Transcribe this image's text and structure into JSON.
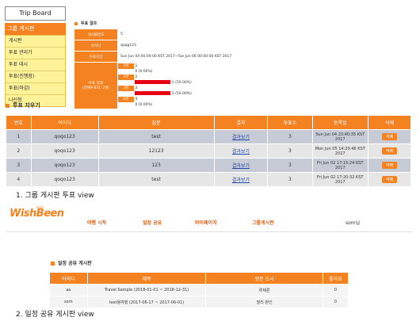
{
  "sidebar": {
    "title": "Trip Board",
    "category": "그룹 게시판",
    "items": [
      "게시판",
      "투표 관리기",
      "투표 대시",
      "투표(진행함)",
      "투표(마감)",
      "나신청"
    ]
  },
  "vote_detail": {
    "header": "투표 결과",
    "rows": [
      {
        "label": "게시물번호",
        "value": "5"
      },
      {
        "label": "아이디",
        "value": "qaqg123"
      },
      {
        "label": "투표기간",
        "value": "Sun Jun 04 00:00:00 KST 2017~Tue Jun 06 00:00:00 KST 2017"
      }
    ],
    "result_label": "투표 결과",
    "result_sublabel": "(전체투표자: 2명)",
    "items": [
      {
        "num": "1번",
        "name": "1",
        "votes": "0 (0.00%)",
        "pct": 0
      },
      {
        "num": "2번",
        "name": "2",
        "votes": "1 (50.00%)",
        "pct": 50
      },
      {
        "num": "3번",
        "name": "3",
        "votes": "1 (50.00%)",
        "pct": 50
      },
      {
        "num": "4번",
        "name": "4",
        "votes": "0 (0.00%)",
        "pct": 0
      }
    ]
  },
  "vote_list": {
    "header": "투표 지우기",
    "columns": [
      "번호",
      "아이디",
      "질문",
      "결과",
      "투표수",
      "등록일",
      "삭제"
    ],
    "rows": [
      {
        "no": "1",
        "id": "qoqo123",
        "q": "test",
        "result": "결과보기",
        "count": "3",
        "date": "Sun Jun 04 23:40:35 KST 2017",
        "del": "삭제"
      },
      {
        "no": "2",
        "id": "qoqo123",
        "q": "12123",
        "result": "결과보기",
        "count": "3",
        "date": "Mon Jun 05 14:20:46 KST 2017",
        "del": "삭제"
      },
      {
        "no": "3",
        "id": "qoqo123",
        "q": "123",
        "result": "결과보기",
        "count": "3",
        "date": "Fri Jun 02 17:15:24 KST 2017",
        "del": "삭제"
      },
      {
        "no": "4",
        "id": "qoqo123",
        "q": "test",
        "result": "결과보기",
        "count": "3",
        "date": "Fri Jun 02 17:20:32 KST 2017",
        "del": "삭제"
      }
    ]
  },
  "caption1": "1. 그룹 게시판 투표 view",
  "navbar": {
    "logo": "WishBeen",
    "logo_beta": "beta",
    "items": [
      "여행 시작",
      "일정 공유",
      "마이페이지",
      "그룹게시판"
    ],
    "user": "som님"
  },
  "share": {
    "header": "일정 공유 게시판",
    "columns": [
      "아이디",
      "제목",
      "방문 도시",
      "좋아요"
    ],
    "rows": [
      {
        "id": "aa",
        "title": "Travel Sample (2018-01-01 ~ 2018-12-31)",
        "city": "루체른",
        "likes": "0"
      },
      {
        "id": "som",
        "title": "test용여행 (2017-06-17 ~ 2017-06-01)",
        "city": "발리 판인",
        "likes": "0"
      }
    ]
  },
  "caption2": "2. 일정 공유 게시판 view"
}
